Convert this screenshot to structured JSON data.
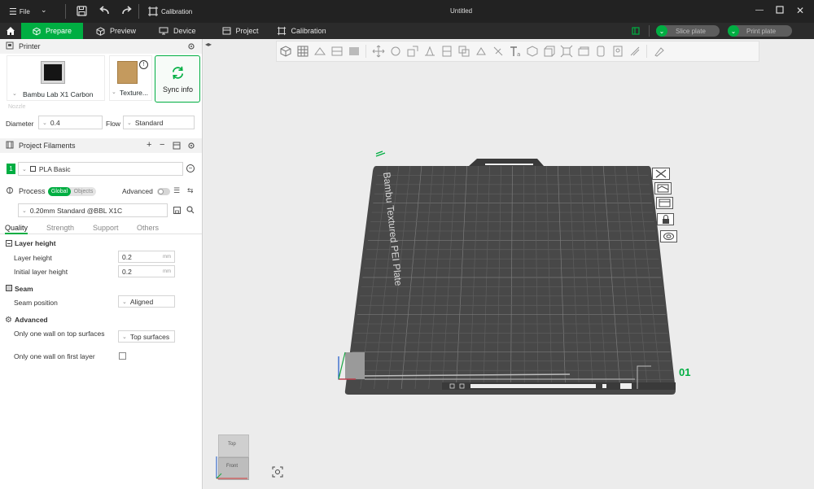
{
  "titlebar": {
    "menu_label": "File",
    "calibration_label": "Calibration",
    "window_title": "Untitled"
  },
  "tabs": [
    {
      "label": "Prepare",
      "icon": "cube-icon"
    },
    {
      "label": "Preview",
      "icon": "eye-icon"
    },
    {
      "label": "Device",
      "icon": "monitor-icon"
    },
    {
      "label": "Project",
      "icon": "folder-icon"
    },
    {
      "label": "Calibration",
      "icon": "calibration-icon"
    }
  ],
  "actions": {
    "slice_label": "Slice plate",
    "print_label": "Print plate"
  },
  "printer": {
    "section_title": "Printer",
    "printer_name": "Bambu Lab X1 Carbon",
    "plate_name": "Texture...",
    "sync_label": "Sync info",
    "nozzle_label": "Nozzle",
    "diameter_label": "Diameter",
    "diameter_value": "0.4",
    "flow_label": "Flow",
    "flow_value": "Standard"
  },
  "filaments": {
    "section_title": "Project Filaments",
    "slot_number": "1",
    "filament_name": "PLA Basic"
  },
  "process": {
    "section_title": "Process",
    "scope_global": "Global",
    "scope_objects": "Objects",
    "advanced_label": "Advanced",
    "preset": "0.20mm Standard @BBL X1C",
    "tabs": [
      "Quality",
      "Strength",
      "Support",
      "Others"
    ],
    "groups": [
      {
        "title": "Layer height",
        "rows": [
          {
            "label": "Layer height",
            "value": "0.2",
            "unit": "mm"
          },
          {
            "label": "Initial layer height",
            "value": "0.2",
            "unit": "mm"
          }
        ]
      },
      {
        "title": "Seam",
        "rows": [
          {
            "label": "Seam position",
            "value": "Aligned"
          }
        ]
      },
      {
        "title": "Advanced",
        "rows": [
          {
            "label": "Only one wall on top surfaces",
            "value": "Top surfaces"
          },
          {
            "label": "Only one wall on first layer",
            "value": ""
          }
        ]
      }
    ]
  },
  "viewport": {
    "plate_label": "Bambu Textured PEI Plate",
    "plate_number": "01",
    "view_cube_top": "Top",
    "view_cube_front": "Front"
  },
  "colors": {
    "accent": "#00ae42",
    "titlebar": "#222222",
    "tabbar": "#2b2b2b",
    "plate": "#4a4a4a"
  }
}
